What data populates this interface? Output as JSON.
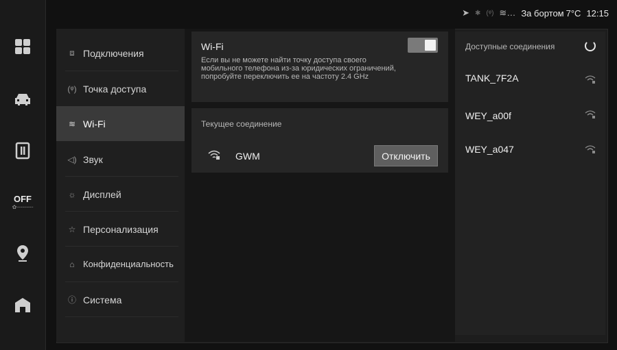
{
  "status_bar": {
    "icons": [
      "location-arrow-icon",
      "bluetooth-icon",
      "hotspot-icon",
      "wifi-icon"
    ],
    "outside_label": "За бортом",
    "outside_temp": "7°C",
    "time": "12:15"
  },
  "left_bar": {
    "items": [
      {
        "name": "apps-grid-icon"
      },
      {
        "name": "car-icon"
      },
      {
        "name": "media-icon"
      },
      {
        "name": "climate-off",
        "label": "OFF"
      },
      {
        "name": "navigation-pin-icon"
      },
      {
        "name": "home-icon"
      }
    ]
  },
  "menu": {
    "items": [
      {
        "label": "Подключения",
        "icon": "connection-icon"
      },
      {
        "label": "Точка доступа",
        "icon": "hotspot-icon"
      },
      {
        "label": "Wi-Fi",
        "icon": "wifi-icon",
        "active": true
      },
      {
        "label": "Звук",
        "icon": "speaker-icon"
      },
      {
        "label": "Дисплей",
        "icon": "sun-icon"
      },
      {
        "label": "Персонализация",
        "icon": "sparkle-icon"
      },
      {
        "label": "Конфиденциальность",
        "icon": "lock-icon"
      },
      {
        "label": "Система",
        "icon": "info-icon"
      }
    ]
  },
  "wifi": {
    "title": "Wi-Fi",
    "description": "Если вы не можете найти точку доступа своего мобильного телефона из-за юридических ограничений, попробуйте переключить ее на частоту 2.4 GHz",
    "enabled": true
  },
  "current_connection": {
    "label": "Текущее соединение",
    "network": "GWM",
    "disconnect_label": "Отключить"
  },
  "available": {
    "title": "Доступные соединения",
    "networks": [
      {
        "name": "TANK_7F2A"
      },
      {
        "name": "WEY_a00f"
      },
      {
        "name": "WEY_a047"
      }
    ]
  }
}
